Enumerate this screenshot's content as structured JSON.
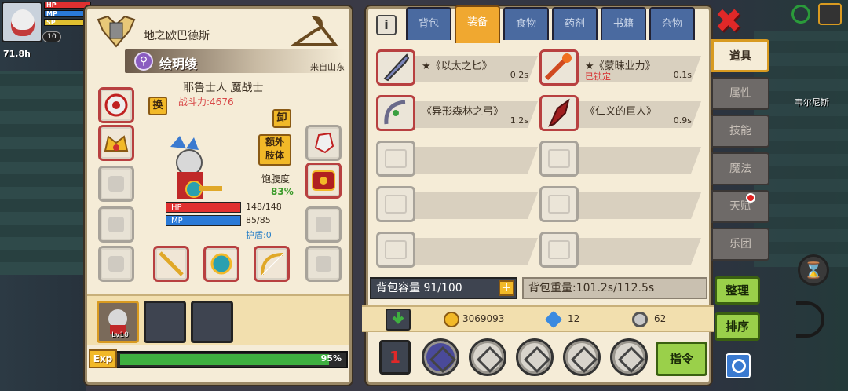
{
  "hud": {
    "hp_label": "HP",
    "mp_label": "MP",
    "sp_label": "SP",
    "hp_value": "148",
    "level": "10",
    "timer": "71.8h"
  },
  "character": {
    "region": "地之欧巴德斯",
    "name": "绘玥绫",
    "origin": "来自山东",
    "race_class": "耶鲁士人 魔战士",
    "power": "战斗力:4676",
    "swap_label": "换",
    "unequip_label": "卸",
    "extra_limb_label": "额外\n肢体",
    "satiety_label": "饱腹度",
    "satiety_value": "83%",
    "hp_label": "HP",
    "hp_value": "148/148",
    "hp_fraction": 1.0,
    "mp_label": "MP",
    "mp_value": "85/85",
    "mp_fraction": 1.0,
    "shield": "护盾:0",
    "party_level": "Lv10",
    "exp_label": "Exp",
    "exp_value": "95%",
    "exp_fraction": 0.95
  },
  "tabs": [
    {
      "label": "背包"
    },
    {
      "label": "装备"
    },
    {
      "label": "食物"
    },
    {
      "label": "药剂"
    },
    {
      "label": "书籍"
    },
    {
      "label": "杂物"
    }
  ],
  "items": [
    {
      "name": "★《以太之匕》",
      "weight": "0.2s",
      "locked": ""
    },
    {
      "name": "★《蒙昧业力》",
      "weight": "0.1s",
      "locked": "已锁定"
    },
    {
      "name": "《异形森林之弓》",
      "weight": "1.2s",
      "locked": ""
    },
    {
      "name": "《仁义的巨人》",
      "weight": "0.9s",
      "locked": ""
    }
  ],
  "bag": {
    "capacity": "背包容量 91/100",
    "weight": "背包重量:101.2s/112.5s",
    "plus": "+"
  },
  "currency": {
    "gold": "3069093",
    "gems": "12",
    "tokens": "62"
  },
  "command_label": "指令",
  "side_tabs": [
    {
      "label": "道具"
    },
    {
      "label": "属性"
    },
    {
      "label": "技能"
    },
    {
      "label": "魔法"
    },
    {
      "label": "天赋"
    },
    {
      "label": "乐团"
    }
  ],
  "side_buttons": {
    "organize": "整理",
    "sort": "排序"
  },
  "close_label": "✖",
  "town_name": "韦尔尼斯",
  "colors": {
    "accent": "#f0a830",
    "tab_blue": "#4a6aa0",
    "hp": "#e03030",
    "mp": "#2a7ad8",
    "exp": "#3fb040",
    "panel": "#f5ecd7"
  }
}
